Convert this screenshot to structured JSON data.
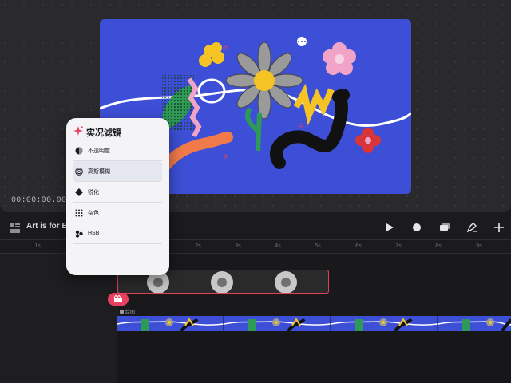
{
  "preview": {
    "timecode": "00:00:00.001",
    "canvas_bg": "#3d4fd6"
  },
  "toolbar": {
    "project_title": "Art is for Eve",
    "icons": [
      "play-icon",
      "record-icon",
      "layers-icon",
      "pen-icon",
      "plus-icon"
    ]
  },
  "ruler": {
    "ticks": [
      "1s",
      "2s",
      "3s",
      "4s",
      "5s",
      "6s",
      "7s",
      "8s",
      "9s"
    ]
  },
  "popover": {
    "title": "实况滤镜",
    "items": [
      {
        "label": "不透明度",
        "icon": "opacity-icon"
      },
      {
        "label": "高斯模糊",
        "icon": "blur-icon",
        "selected": true
      },
      {
        "label": "锐化",
        "icon": "sharpen-icon"
      },
      {
        "label": "杂色",
        "icon": "noise-icon"
      },
      {
        "label": "HSB",
        "icon": "hsb-icon"
      }
    ]
  },
  "timeline": {
    "main_track_label": "绘图",
    "accent": "#e8405f"
  }
}
